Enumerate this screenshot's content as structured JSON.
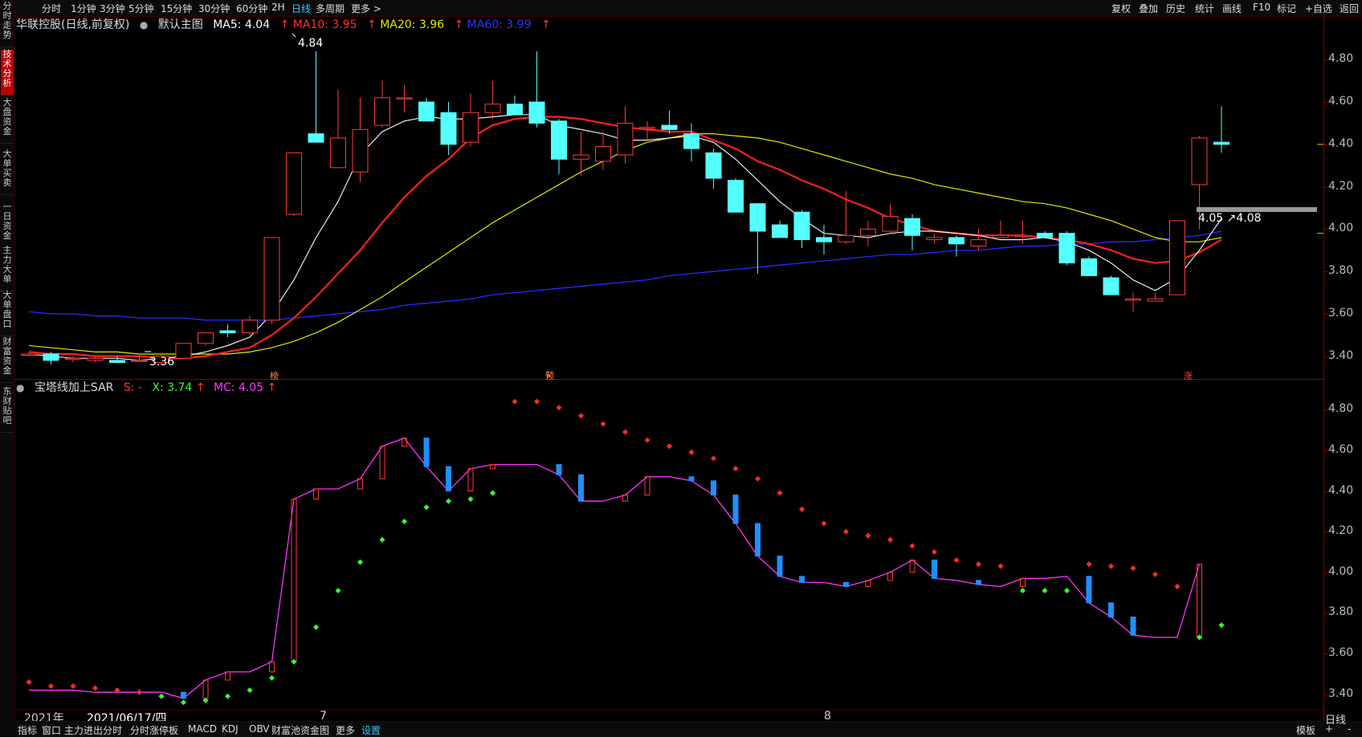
{
  "topbar": {
    "periods": [
      "分时",
      "1分钟",
      "3分钟",
      "5分钟",
      "15分钟",
      "30分钟",
      "60分钟",
      "2H",
      "日线",
      "多周期",
      "更多 >"
    ],
    "active_period": "日线",
    "right_items": [
      "复权",
      "叠加",
      "历史",
      "统计",
      "画线",
      "F10",
      "标记",
      "+自选",
      "返回"
    ]
  },
  "left_tabs": [
    "分时走势",
    "技术分析",
    "大盘资金",
    "大单买卖",
    "一日资金",
    "主力大单",
    "大单盘口",
    "财富资金",
    "东财贴吧"
  ],
  "left_tab_active": "技术分析",
  "main_header": {
    "stock": "华联控股(日线,前复权)",
    "chart_name": "默认主图",
    "ma5": "MA5: 4.04",
    "ma10": "MA10: 3.95",
    "ma20": "MA20: 3.96",
    "ma60": "MA60: 3.99",
    "arrow": "↑"
  },
  "indicator_header": {
    "name": "宝塔线加上SAR",
    "s": "S: -",
    "x": "X: 3.74",
    "mc": "MC: 4.05",
    "arrow": "↑"
  },
  "annotations": {
    "high": "4.84",
    "low": "3.36",
    "crosshair_box": "4.05 ↗4.08",
    "markers": [
      "榜",
      "$",
      "预",
      "涨"
    ]
  },
  "bottom": {
    "date_labels": [
      "2021年",
      "2021/06/17/四",
      "7",
      "8"
    ],
    "tabs": [
      "指标",
      "窗口",
      "主力进出分时",
      "分时涨停板",
      "MACD",
      "KDJ",
      "OBV",
      "财富池资金图",
      "更多",
      "设置"
    ],
    "active_tab": "设置",
    "right_items": [
      "模板",
      "+",
      "-"
    ],
    "period": "日线"
  },
  "colors": {
    "up": "#ff3b3b",
    "down": "#54ffff",
    "ma5": "#ffffff",
    "ma10": "#ff2020",
    "ma20": "#e6e600",
    "ma60": "#2a2aff",
    "mc": "#ff33ff",
    "sar_green": "#33ff33"
  },
  "chart_data": [
    {
      "type": "candlestick",
      "title": "华联控股(日线,前复权)",
      "ylim": [
        3.3,
        4.93
      ],
      "yticks": [
        3.4,
        3.6,
        3.8,
        4.0,
        4.2,
        4.4,
        4.6,
        4.8
      ],
      "candles": [
        {
          "o": 3.41,
          "h": 3.42,
          "l": 3.4,
          "c": 3.41
        },
        {
          "o": 3.41,
          "h": 3.42,
          "l": 3.36,
          "c": 3.38
        },
        {
          "o": 3.39,
          "h": 3.4,
          "l": 3.37,
          "c": 3.39
        },
        {
          "o": 3.38,
          "h": 3.4,
          "l": 3.37,
          "c": 3.39
        },
        {
          "o": 3.38,
          "h": 3.4,
          "l": 3.37,
          "c": 3.37
        },
        {
          "o": 3.38,
          "h": 3.4,
          "l": 3.37,
          "c": 3.38
        },
        {
          "o": 3.37,
          "h": 3.41,
          "l": 3.36,
          "c": 3.4
        },
        {
          "o": 3.39,
          "h": 3.46,
          "l": 3.39,
          "c": 3.46
        },
        {
          "o": 3.46,
          "h": 3.51,
          "l": 3.45,
          "c": 3.51
        },
        {
          "o": 3.52,
          "h": 3.55,
          "l": 3.49,
          "c": 3.51
        },
        {
          "o": 3.51,
          "h": 3.59,
          "l": 3.5,
          "c": 3.57
        },
        {
          "o": 3.57,
          "h": 3.96,
          "l": 3.55,
          "c": 3.96
        },
        {
          "o": 4.07,
          "h": 4.36,
          "l": 4.06,
          "c": 4.36
        },
        {
          "o": 4.45,
          "h": 4.84,
          "l": 4.43,
          "c": 4.41
        },
        {
          "o": 4.29,
          "h": 4.66,
          "l": 4.29,
          "c": 4.43
        },
        {
          "o": 4.27,
          "h": 4.62,
          "l": 4.22,
          "c": 4.47
        },
        {
          "o": 4.49,
          "h": 4.7,
          "l": 4.48,
          "c": 4.62
        },
        {
          "o": 4.62,
          "h": 4.68,
          "l": 4.55,
          "c": 4.62
        },
        {
          "o": 4.6,
          "h": 4.62,
          "l": 4.51,
          "c": 4.51
        },
        {
          "o": 4.55,
          "h": 4.6,
          "l": 4.35,
          "c": 4.4
        },
        {
          "o": 4.41,
          "h": 4.64,
          "l": 4.39,
          "c": 4.55
        },
        {
          "o": 4.55,
          "h": 4.7,
          "l": 4.52,
          "c": 4.59
        },
        {
          "o": 4.59,
          "h": 4.63,
          "l": 4.55,
          "c": 4.54
        },
        {
          "o": 4.6,
          "h": 4.84,
          "l": 4.48,
          "c": 4.5
        },
        {
          "o": 4.51,
          "h": 4.52,
          "l": 4.26,
          "c": 4.33
        },
        {
          "o": 4.33,
          "h": 4.46,
          "l": 4.25,
          "c": 4.35
        },
        {
          "o": 4.32,
          "h": 4.46,
          "l": 4.28,
          "c": 4.39
        },
        {
          "o": 4.35,
          "h": 4.58,
          "l": 4.31,
          "c": 4.5
        },
        {
          "o": 4.48,
          "h": 4.51,
          "l": 4.42,
          "c": 4.48
        },
        {
          "o": 4.49,
          "h": 4.56,
          "l": 4.45,
          "c": 4.47
        },
        {
          "o": 4.45,
          "h": 4.5,
          "l": 4.32,
          "c": 4.38
        },
        {
          "o": 4.36,
          "h": 4.38,
          "l": 4.19,
          "c": 4.24
        },
        {
          "o": 4.23,
          "h": 4.24,
          "l": 4.08,
          "c": 4.08
        },
        {
          "o": 4.12,
          "h": 4.12,
          "l": 3.79,
          "c": 3.99
        },
        {
          "o": 4.02,
          "h": 4.04,
          "l": 3.96,
          "c": 3.96
        },
        {
          "o": 4.08,
          "h": 4.09,
          "l": 3.91,
          "c": 3.95
        },
        {
          "o": 3.96,
          "h": 4.02,
          "l": 3.88,
          "c": 3.94
        },
        {
          "o": 3.94,
          "h": 4.18,
          "l": 3.93,
          "c": 3.97
        },
        {
          "o": 3.97,
          "h": 4.04,
          "l": 3.92,
          "c": 4.0
        },
        {
          "o": 3.99,
          "h": 4.12,
          "l": 3.98,
          "c": 4.06
        },
        {
          "o": 4.05,
          "h": 4.07,
          "l": 3.9,
          "c": 3.97
        },
        {
          "o": 3.95,
          "h": 3.98,
          "l": 3.93,
          "c": 3.96
        },
        {
          "o": 3.96,
          "h": 3.97,
          "l": 3.87,
          "c": 3.93
        },
        {
          "o": 3.92,
          "h": 4.0,
          "l": 3.9,
          "c": 3.95
        },
        {
          "o": 3.96,
          "h": 4.04,
          "l": 3.96,
          "c": 3.97
        },
        {
          "o": 3.97,
          "h": 4.04,
          "l": 3.93,
          "c": 3.97
        },
        {
          "o": 3.98,
          "h": 3.99,
          "l": 3.96,
          "c": 3.96
        },
        {
          "o": 3.98,
          "h": 3.99,
          "l": 3.83,
          "c": 3.84
        },
        {
          "o": 3.86,
          "h": 3.87,
          "l": 3.78,
          "c": 3.78
        },
        {
          "o": 3.77,
          "h": 3.78,
          "l": 3.69,
          "c": 3.69
        },
        {
          "o": 3.67,
          "h": 3.7,
          "l": 3.61,
          "c": 3.67
        },
        {
          "o": 3.66,
          "h": 3.7,
          "l": 3.66,
          "c": 3.67
        },
        {
          "o": 3.69,
          "h": 4.04,
          "l": 3.69,
          "c": 4.04
        },
        {
          "o": 4.21,
          "h": 4.44,
          "l": 4.0,
          "c": 4.43
        },
        {
          "o": 4.41,
          "h": 4.58,
          "l": 4.36,
          "c": 4.4
        }
      ],
      "ma5": [
        3.41,
        3.4,
        3.39,
        3.39,
        3.39,
        3.38,
        3.39,
        3.4,
        3.42,
        3.45,
        3.49,
        3.6,
        3.76,
        3.96,
        4.13,
        4.35,
        4.46,
        4.51,
        4.53,
        4.52,
        4.52,
        4.53,
        4.54,
        4.54,
        4.49,
        4.47,
        4.45,
        4.42,
        4.42,
        4.43,
        4.44,
        4.41,
        4.33,
        4.23,
        4.13,
        4.05,
        3.98,
        3.97,
        3.96,
        3.98,
        3.99,
        3.99,
        3.98,
        3.97,
        3.95,
        3.95,
        3.96,
        3.94,
        3.9,
        3.84,
        3.76,
        3.71,
        3.77,
        3.9,
        4.05
      ],
      "ma10": [
        3.42,
        3.41,
        3.41,
        3.4,
        3.4,
        3.4,
        3.39,
        3.39,
        3.4,
        3.42,
        3.44,
        3.5,
        3.58,
        3.68,
        3.79,
        3.9,
        4.03,
        4.15,
        4.25,
        4.33,
        4.43,
        4.49,
        4.52,
        4.53,
        4.53,
        4.52,
        4.5,
        4.48,
        4.47,
        4.46,
        4.46,
        4.42,
        4.38,
        4.32,
        4.28,
        4.23,
        4.19,
        4.14,
        4.1,
        4.05,
        4.02,
        3.99,
        3.98,
        3.97,
        3.97,
        3.97,
        3.96,
        3.95,
        3.93,
        3.9,
        3.86,
        3.84,
        3.85,
        3.89,
        3.95
      ],
      "ma20": [
        3.45,
        3.44,
        3.43,
        3.42,
        3.42,
        3.41,
        3.41,
        3.41,
        3.41,
        3.41,
        3.42,
        3.44,
        3.47,
        3.51,
        3.56,
        3.62,
        3.68,
        3.75,
        3.82,
        3.89,
        3.96,
        4.03,
        4.09,
        4.15,
        4.21,
        4.27,
        4.32,
        4.37,
        4.41,
        4.43,
        4.45,
        4.45,
        4.44,
        4.43,
        4.41,
        4.38,
        4.35,
        4.32,
        4.29,
        4.26,
        4.24,
        4.21,
        4.19,
        4.17,
        4.15,
        4.13,
        4.12,
        4.1,
        4.07,
        4.04,
        4.0,
        3.96,
        3.94,
        3.94,
        3.96
      ],
      "ma60": [
        3.61,
        3.6,
        3.6,
        3.59,
        3.59,
        3.58,
        3.58,
        3.58,
        3.57,
        3.57,
        3.57,
        3.57,
        3.58,
        3.59,
        3.6,
        3.61,
        3.62,
        3.64,
        3.65,
        3.66,
        3.67,
        3.69,
        3.7,
        3.71,
        3.72,
        3.73,
        3.74,
        3.75,
        3.76,
        3.78,
        3.79,
        3.8,
        3.81,
        3.82,
        3.83,
        3.84,
        3.85,
        3.86,
        3.87,
        3.88,
        3.88,
        3.89,
        3.9,
        3.9,
        3.91,
        3.92,
        3.92,
        3.93,
        3.93,
        3.94,
        3.94,
        3.95,
        3.96,
        3.97,
        3.99
      ]
    },
    {
      "type": "line",
      "title": "宝塔线加上SAR",
      "ylim": [
        3.32,
        4.88
      ],
      "yticks": [
        3.4,
        3.6,
        3.8,
        4.0,
        4.2,
        4.4,
        4.6,
        4.8
      ],
      "series": [
        {
          "name": "MC",
          "values": [
            3.42,
            3.42,
            3.42,
            3.41,
            3.41,
            3.41,
            3.41,
            3.38,
            3.47,
            3.51,
            3.51,
            3.56,
            4.36,
            4.41,
            4.41,
            4.46,
            4.62,
            4.66,
            4.52,
            4.4,
            4.51,
            4.53,
            4.53,
            4.53,
            4.48,
            4.35,
            4.35,
            4.38,
            4.47,
            4.47,
            4.45,
            4.38,
            4.24,
            4.08,
            3.98,
            3.95,
            3.95,
            3.93,
            3.96,
            4.0,
            4.06,
            3.97,
            3.96,
            3.94,
            3.93,
            3.97,
            3.97,
            3.98,
            3.85,
            3.78,
            3.69,
            3.68,
            3.68,
            4.04
          ]
        },
        {
          "name": "SAR",
          "values": [
            3.46,
            3.44,
            3.44,
            3.43,
            3.42,
            3.41,
            3.39,
            3.36,
            3.37,
            3.39,
            3.42,
            3.48,
            3.56,
            3.73,
            3.91,
            4.05,
            4.16,
            4.25,
            4.32,
            4.35,
            4.36,
            4.39,
            4.84,
            4.84,
            4.81,
            4.77,
            4.73,
            4.69,
            4.65,
            4.62,
            4.59,
            4.56,
            4.51,
            4.46,
            4.39,
            4.31,
            4.24,
            4.2,
            4.18,
            4.16,
            4.13,
            4.1,
            4.06,
            4.04,
            4.03,
            3.91,
            3.91,
            3.91,
            4.04,
            4.03,
            4.02,
            3.99,
            3.93,
            3.68,
            3.74
          ]
        },
        {
          "name": "SAR_trend",
          "values": [
            "r",
            "r",
            "r",
            "r",
            "r",
            "r",
            "g",
            "g",
            "g",
            "g",
            "g",
            "g",
            "g",
            "g",
            "g",
            "g",
            "g",
            "g",
            "g",
            "g",
            "g",
            "g",
            "r",
            "r",
            "r",
            "r",
            "r",
            "r",
            "r",
            "r",
            "r",
            "r",
            "r",
            "r",
            "r",
            "r",
            "r",
            "r",
            "r",
            "r",
            "r",
            "r",
            "r",
            "r",
            "r",
            "g",
            "g",
            "g",
            "r",
            "r",
            "r",
            "r",
            "r",
            "g",
            "g"
          ]
        }
      ]
    }
  ]
}
